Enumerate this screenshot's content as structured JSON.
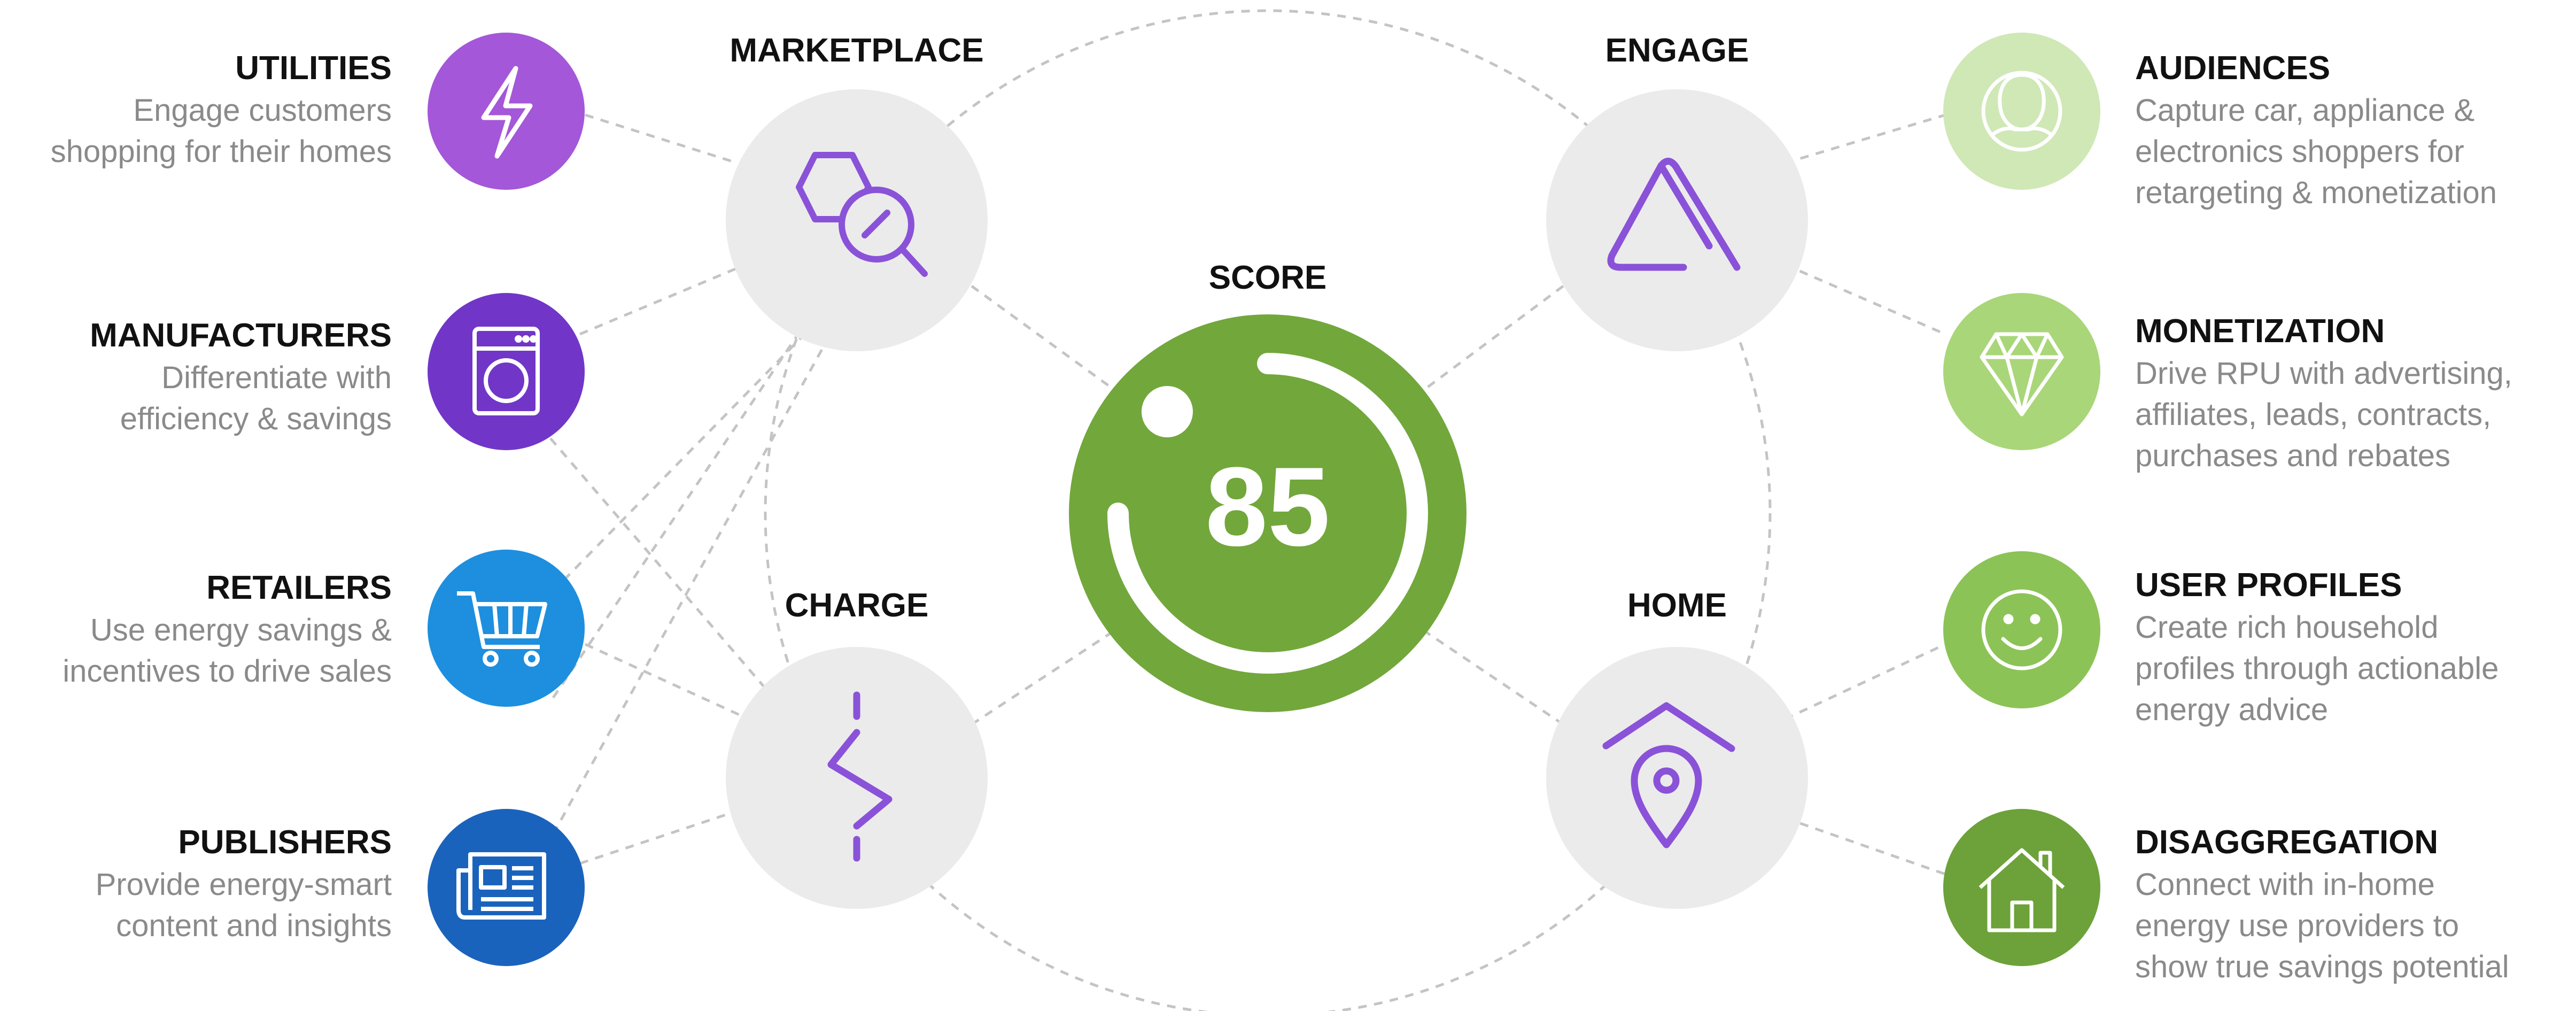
{
  "score": {
    "label": "SCORE",
    "value": "85",
    "color": "#72a73c"
  },
  "hubs": {
    "marketplace": {
      "label": "MARKETPLACE",
      "icon": "magnifier-search-icon"
    },
    "engage": {
      "label": "ENGAGE",
      "icon": "triangle-icon"
    },
    "charge": {
      "label": "CHARGE",
      "icon": "lightning-bolt-icon"
    },
    "home": {
      "label": "HOME",
      "icon": "house-location-pin-icon"
    }
  },
  "left_items": [
    {
      "title": "UTILITIES",
      "lines": [
        "Engage customers",
        "shopping for their homes"
      ],
      "icon": "lightning-bolt-icon",
      "color": "#a457d8"
    },
    {
      "title": "MANUFACTURERS",
      "lines": [
        "Differentiate with",
        "efficiency & savings"
      ],
      "icon": "washing-machine-icon",
      "color": "#7136c8"
    },
    {
      "title": "RETAILERS",
      "lines": [
        "Use energy savings &",
        "incentives to drive sales"
      ],
      "icon": "shopping-cart-icon",
      "color": "#1d8fde"
    },
    {
      "title": "PUBLISHERS",
      "lines": [
        "Provide energy-smart",
        "content and insights"
      ],
      "icon": "newspaper-icon",
      "color": "#1a63bd"
    }
  ],
  "right_items": [
    {
      "title": "AUDIENCES",
      "lines": [
        "Capture car, appliance &",
        "electronics shoppers for",
        "retargeting & monetization"
      ],
      "icon": "user-profile-icon",
      "color": "#cfe8b6"
    },
    {
      "title": "MONETIZATION",
      "lines": [
        "Drive RPU with advertising,",
        "affiliates, leads, contracts,",
        "purchases and rebates"
      ],
      "icon": "diamond-icon",
      "color": "#a9d679"
    },
    {
      "title": "USER PROFILES",
      "lines": [
        "Create rich household",
        "profiles through actionable",
        "energy advice"
      ],
      "icon": "smiley-face-icon",
      "color": "#8cc356"
    },
    {
      "title": "DISAGGREGATION",
      "lines": [
        "Connect with in-home",
        "energy use providers to",
        "show true savings potential"
      ],
      "icon": "house-icon",
      "color": "#6ca239"
    }
  ],
  "colors": {
    "hub_fill": "#ebebeb",
    "hub_icon": "#8a52d8",
    "connector": "#c4c4c4"
  }
}
